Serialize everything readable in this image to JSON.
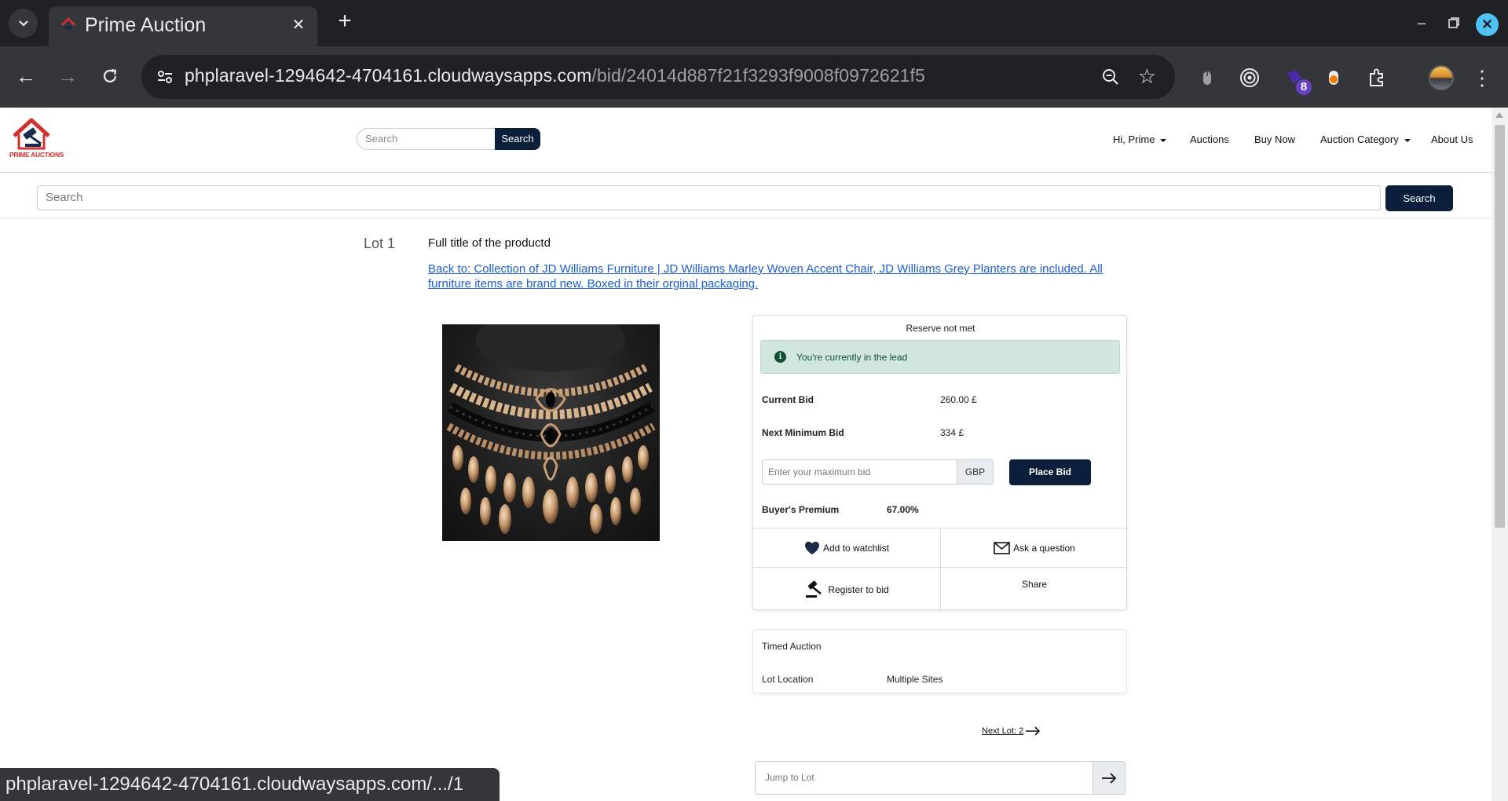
{
  "browser": {
    "tab_title": "Prime Auction",
    "url_host": "phplaravel-1294642-4704161.cloudwaysapps.com",
    "url_path": "/bid/24014d887f21f3293f9008f0972621f5",
    "extension_badge": "8",
    "status_url": "phplaravel-1294642-4704161.cloudwaysapps.com/.../1"
  },
  "header": {
    "logo_text": "PRIME AUCTIONS",
    "search_placeholder": "Search",
    "search_button": "Search",
    "nav": {
      "user": "Hi, Prime",
      "auctions": "Auctions",
      "buy_now": "Buy Now",
      "category": "Auction Category",
      "about": "About Us"
    }
  },
  "search_bar": {
    "placeholder": "Search",
    "button": "Search"
  },
  "lot": {
    "number": "Lot 1",
    "title": "Full title of the productd",
    "back_link": "Back to: Collection of JD Williams Furniture | JD Williams Marley Woven Accent Chair, JD Williams Grey Planters are included. All furniture items are brand new. Boxed in their orginal packaging."
  },
  "bid_panel": {
    "reserve_status": "Reserve not met",
    "lead_message": "You're currently in the lead",
    "current_bid_label": "Current Bid",
    "current_bid_value": "260.00 £",
    "next_min_label": "Next Minimum Bid",
    "next_min_value": "334 £",
    "bid_input_placeholder": "Enter your maximum bid",
    "currency": "GBP",
    "place_bid": "Place Bid",
    "premium_label": "Buyer's Premium",
    "premium_value": "67.00%",
    "actions": {
      "watchlist": "Add to watchlist",
      "question": "Ask a question",
      "register": "Register to bid",
      "share": "Share"
    }
  },
  "lot_info": {
    "auction_type": "Timed Auction",
    "location_label": "Lot Location",
    "location_value": "Multiple Sites"
  },
  "navigation": {
    "next_lot": "Next Lot: 2",
    "jump_placeholder": "Jump to Lot"
  },
  "colors": {
    "primary": "#0b1f3a",
    "alert_bg": "#d1e7dd",
    "alert_text": "#0f5132",
    "link": "#1a5fd8"
  }
}
